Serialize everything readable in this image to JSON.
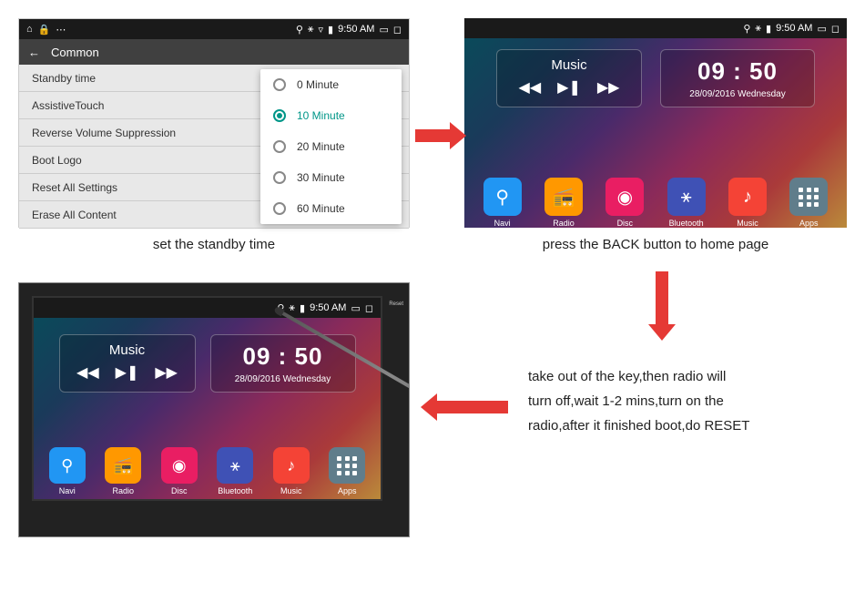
{
  "status": {
    "time": "9:50 AM",
    "icons": {
      "home": "⌂",
      "lock": "🔒",
      "dots": "…",
      "location": "📍",
      "bt": "⚹",
      "wifi": "▾",
      "signal": "▮",
      "battery": "▭"
    }
  },
  "panel1": {
    "header_title": "Common",
    "items": [
      {
        "label": "Standby time"
      },
      {
        "label": "AssistiveTouch"
      },
      {
        "label": "Reverse Volume Suppression"
      },
      {
        "label": "Boot Logo"
      },
      {
        "label": "Reset All Settings"
      },
      {
        "label": "Erase All Content"
      }
    ],
    "dropdown": {
      "options": [
        {
          "label": "0 Minute",
          "selected": false
        },
        {
          "label": "10 Minute",
          "selected": true
        },
        {
          "label": "20 Minute",
          "selected": false
        },
        {
          "label": "30 Minute",
          "selected": false
        },
        {
          "label": "60 Minute",
          "selected": false
        }
      ]
    }
  },
  "home": {
    "music_title": "Music",
    "clock_time": "09 : 50",
    "clock_date": "28/09/2016   Wednesday",
    "apps": [
      {
        "label": "Navi",
        "icon": "pin"
      },
      {
        "label": "Radio",
        "icon": "radio"
      },
      {
        "label": "Disc",
        "icon": "disc"
      },
      {
        "label": "Bluetooth",
        "icon": "bt"
      },
      {
        "label": "Music",
        "icon": "music"
      },
      {
        "label": "Apps",
        "icon": "grid"
      }
    ]
  },
  "captions": {
    "c1": "set the standby time",
    "c2": "press the BACK button to home page",
    "c3a": "take out of the key,then radio will",
    "c3b": "turn off,wait 1-2 mins,turn on the",
    "c3c": "radio,after it finished boot,do RESET"
  },
  "reset_label": "Reset"
}
